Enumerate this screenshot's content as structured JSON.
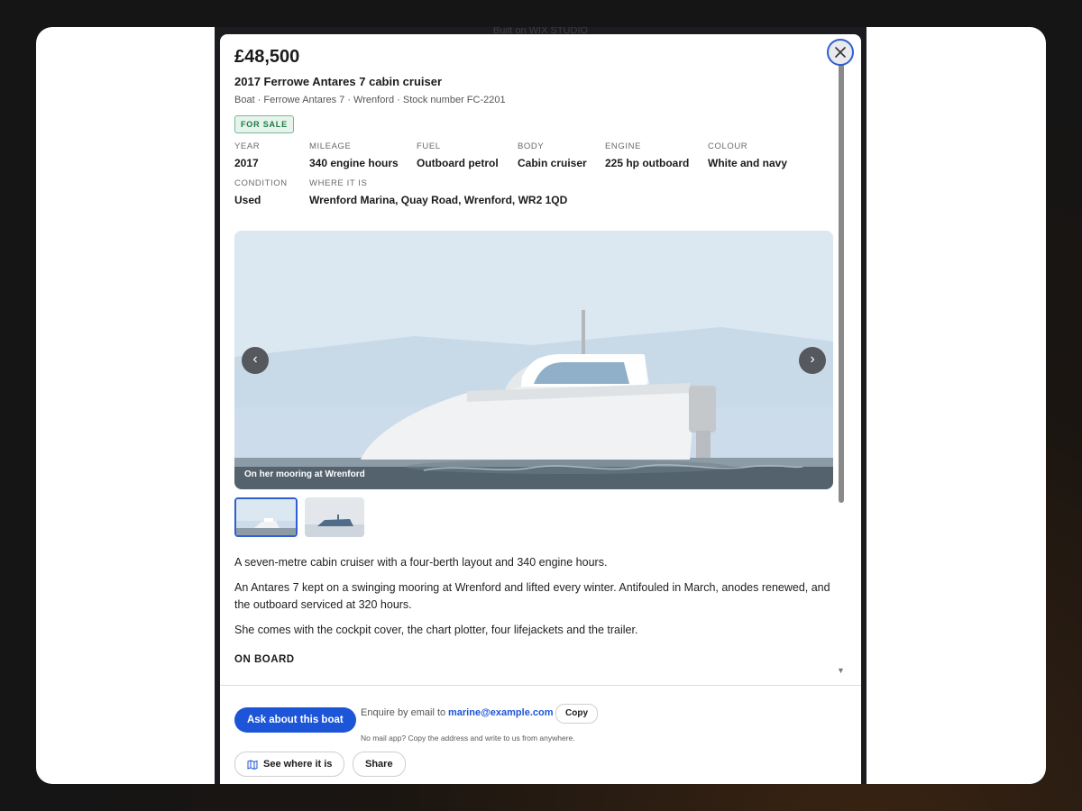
{
  "backdrop": {
    "caption": "Built on WIX STUDIO"
  },
  "listing": {
    "price": "£48,500",
    "title": "2017 Ferrowe Antares 7 cabin cruiser",
    "meta": "Boat · Ferrowe Antares 7 · Wrenford · Stock number FC-2201",
    "status_badge": "FOR SALE"
  },
  "specs": [
    {
      "label": "YEAR",
      "value": "2017"
    },
    {
      "label": "MILEAGE",
      "value": "340 engine hours"
    },
    {
      "label": "FUEL",
      "value": "Outboard petrol"
    },
    {
      "label": "BODY",
      "value": "Cabin cruiser"
    },
    {
      "label": "ENGINE",
      "value": "225 hp outboard"
    },
    {
      "label": "COLOUR",
      "value": "White and navy"
    },
    {
      "label": "CONDITION",
      "value": "Used"
    },
    {
      "label": "WHERE IT IS",
      "value": "Wrenford Marina, Quay Road, Wrenford, WR2 1QD"
    }
  ],
  "gallery": {
    "caption": "On her mooring at Wrenford",
    "prev_label": "‹",
    "next_label": "›",
    "active_thumbnail": 1,
    "thumbnail_count": 2
  },
  "description": {
    "paragraphs": [
      "A seven-metre cabin cruiser with a four-berth layout and 340 engine hours.",
      "An Antares 7 kept on a swinging mooring at Wrenford and lifted every winter. Antifouled in March, anodes renewed, and the outboard serviced at 320 hours.",
      "She comes with the cockpit cover, the chart plotter, four lifejackets and the trailer."
    ],
    "section_heading": "ON BOARD"
  },
  "footer": {
    "primary_button": "Ask about this boat",
    "enquire_text": "Enquire by email to",
    "email": "marine@example.com",
    "copy_button": "Copy",
    "hint": "No mail app? Copy the address and write to us from anywhere.",
    "map_button": "See where it is",
    "share_button": "Share"
  },
  "icons": {
    "close": "close-icon",
    "map": "map-icon",
    "scroll_down": "triangle-down-icon"
  },
  "colors": {
    "accent": "#1d55d8",
    "badge_bg": "#e6f4ec",
    "badge_text": "#1f7a44"
  }
}
